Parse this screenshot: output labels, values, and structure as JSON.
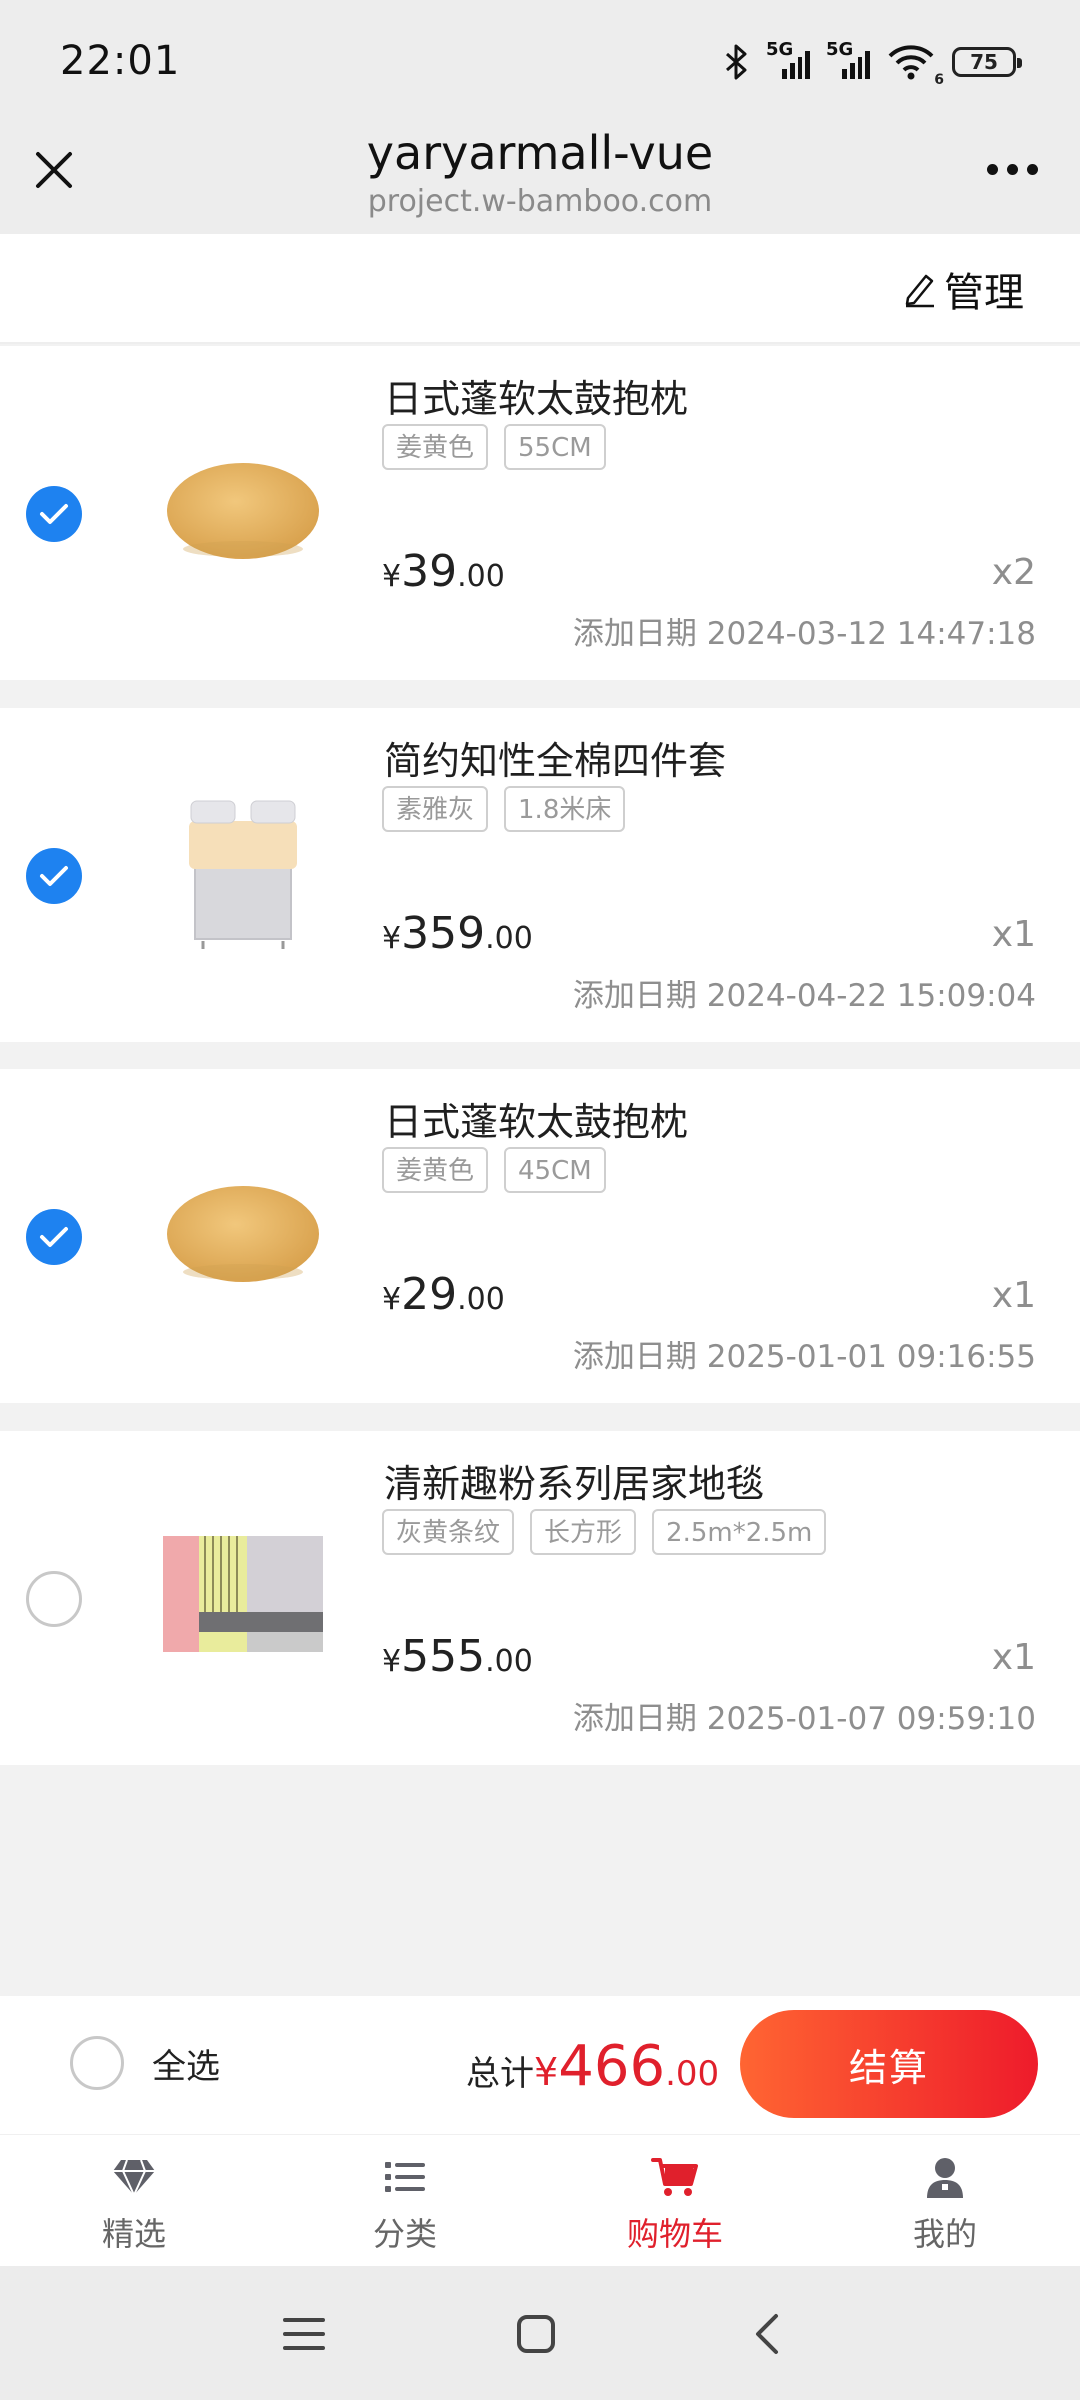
{
  "status_bar": {
    "time": "22:01",
    "network_1": "5G",
    "network_2": "5G",
    "wifi_badge": "6",
    "battery": "75",
    "icons": [
      "bluetooth-icon",
      "signal-icon",
      "signal-icon",
      "wifi-icon",
      "battery-icon"
    ]
  },
  "header": {
    "title": "yaryarmall-vue",
    "domain": "project.w-bamboo.com",
    "close_icon": "close-icon",
    "more_icon": "more-icon"
  },
  "manage": {
    "label": "管理",
    "icon": "edit-icon"
  },
  "cart_items": [
    {
      "title": "日式蓬软太鼓抱枕",
      "tags": [
        "姜黄色",
        "55CM"
      ],
      "currency": "¥",
      "price_int": "39",
      "price_dec": ".00",
      "qty": "x2",
      "date": "添加日期 2024-03-12 14:47:18",
      "checked": true,
      "image": "round-cushion"
    },
    {
      "title": "简约知性全棉四件套",
      "tags": [
        "素雅灰",
        "1.8米床"
      ],
      "currency": "¥",
      "price_int": "359",
      "price_dec": ".00",
      "qty": "x1",
      "date": "添加日期 2024-04-22 15:09:04",
      "checked": true,
      "image": "bedding-set"
    },
    {
      "title": "日式蓬软太鼓抱枕",
      "tags": [
        "姜黄色",
        "45CM"
      ],
      "currency": "¥",
      "price_int": "29",
      "price_dec": ".00",
      "qty": "x1",
      "date": "添加日期 2025-01-01 09:16:55",
      "checked": true,
      "image": "round-cushion"
    },
    {
      "title": "清新趣粉系列居家地毯",
      "tags": [
        "灰黄条纹",
        "长方形",
        "2.5m*2.5m"
      ],
      "currency": "¥",
      "price_int": "555",
      "price_dec": ".00",
      "qty": "x1",
      "date": "添加日期 2025-01-07 09:59:10",
      "checked": false,
      "image": "rug"
    }
  ],
  "summary": {
    "select_all": "全选",
    "total_label": "总计",
    "currency": "¥",
    "total_int": "466",
    "total_dec": ".00",
    "checkout": "结算"
  },
  "tabs": [
    {
      "label": "精选",
      "icon": "diamond-icon",
      "active": false
    },
    {
      "label": "分类",
      "icon": "list-icon",
      "active": false
    },
    {
      "label": "购物车",
      "icon": "cart-icon",
      "active": true
    },
    {
      "label": "我的",
      "icon": "user-icon",
      "active": false
    }
  ],
  "colors": {
    "accent": "#e0202c",
    "checkbox": "#1e82f0",
    "checkout_gradient_start": "#ff6532",
    "checkout_gradient_end": "#ee1b2b"
  }
}
